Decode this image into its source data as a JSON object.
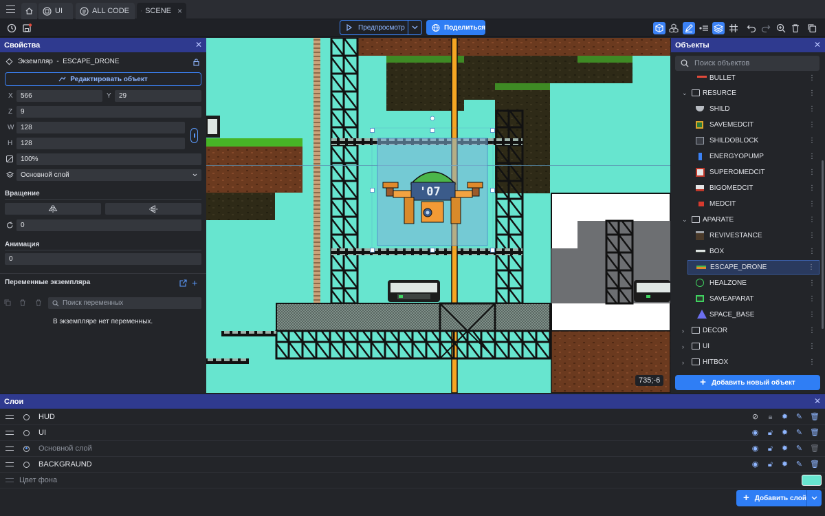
{
  "tabs": {
    "ui": "UI",
    "allcode": "ALL CODE",
    "scene": "SCENE"
  },
  "toolbar": {
    "preview_label": "Предпросмотр",
    "share_label": "Поделиться"
  },
  "properties": {
    "title": "Свойства",
    "instance_label": "Экземпляр  -  ESCAPE_DRONE",
    "edit_button": "Редактировать объект",
    "x_label": "X",
    "x_value": "566",
    "y_label": "Y",
    "y_value": "29",
    "z_label": "Z",
    "z_value": "9",
    "w_label": "W",
    "w_value": "128",
    "h_label": "H",
    "h_value": "128",
    "opacity_value": "100%",
    "layer_value": "Основной слой",
    "rotation_label": "Вращение",
    "rotation_value": "0",
    "animation_label": "Анимация",
    "animation_value": "0",
    "vars_title": "Переменные экземпляра",
    "vars_search_placeholder": "Поиск переменных",
    "vars_empty": "В экземпляре нет переменных."
  },
  "canvas": {
    "coord_readout": "735;-6",
    "drone_label": "'07"
  },
  "objects": {
    "title": "Объекты",
    "search_placeholder": "Поиск объектов",
    "items": [
      {
        "name": "BULLET",
        "type": "item"
      },
      {
        "name": "RESURCE",
        "type": "group-open"
      },
      {
        "name": "SHILD",
        "type": "item"
      },
      {
        "name": "SAVEMEDCIT",
        "type": "item"
      },
      {
        "name": "SHILDOBLOCK",
        "type": "item"
      },
      {
        "name": "ENERGYOPUMP",
        "type": "item"
      },
      {
        "name": "SUPEROMEDCIT",
        "type": "item"
      },
      {
        "name": "BIGOMEDCIT",
        "type": "item"
      },
      {
        "name": "MEDCIT",
        "type": "item"
      },
      {
        "name": "APARATE",
        "type": "group-open"
      },
      {
        "name": "REVIVESTANCE",
        "type": "item"
      },
      {
        "name": "BOX",
        "type": "item"
      },
      {
        "name": "ESCAPE_DRONE",
        "type": "item-selected"
      },
      {
        "name": "HEALZONE",
        "type": "item"
      },
      {
        "name": "SAVEAPARAT",
        "type": "item"
      },
      {
        "name": "SPACE_BASE",
        "type": "item"
      },
      {
        "name": "DECOR",
        "type": "group"
      },
      {
        "name": "UI",
        "type": "group"
      },
      {
        "name": "HITBOX",
        "type": "group"
      }
    ],
    "add_button": "Добавить новый объект"
  },
  "layers": {
    "title": "Слои",
    "items": [
      {
        "name": "HUD",
        "visible": false,
        "active": false
      },
      {
        "name": "UI",
        "visible": true,
        "active": false
      },
      {
        "name": "Основной слой",
        "visible": true,
        "active": true
      },
      {
        "name": "BACKGRAUND",
        "visible": true,
        "active": false
      }
    ],
    "bg_color_label": "Цвет фона",
    "bg_color": "#67e5cf",
    "add_button": "Добавить слой"
  },
  "colors": {
    "accent": "#2f7ef5",
    "panel_header": "#2f3a8f",
    "selection": "#2a3a5e"
  }
}
